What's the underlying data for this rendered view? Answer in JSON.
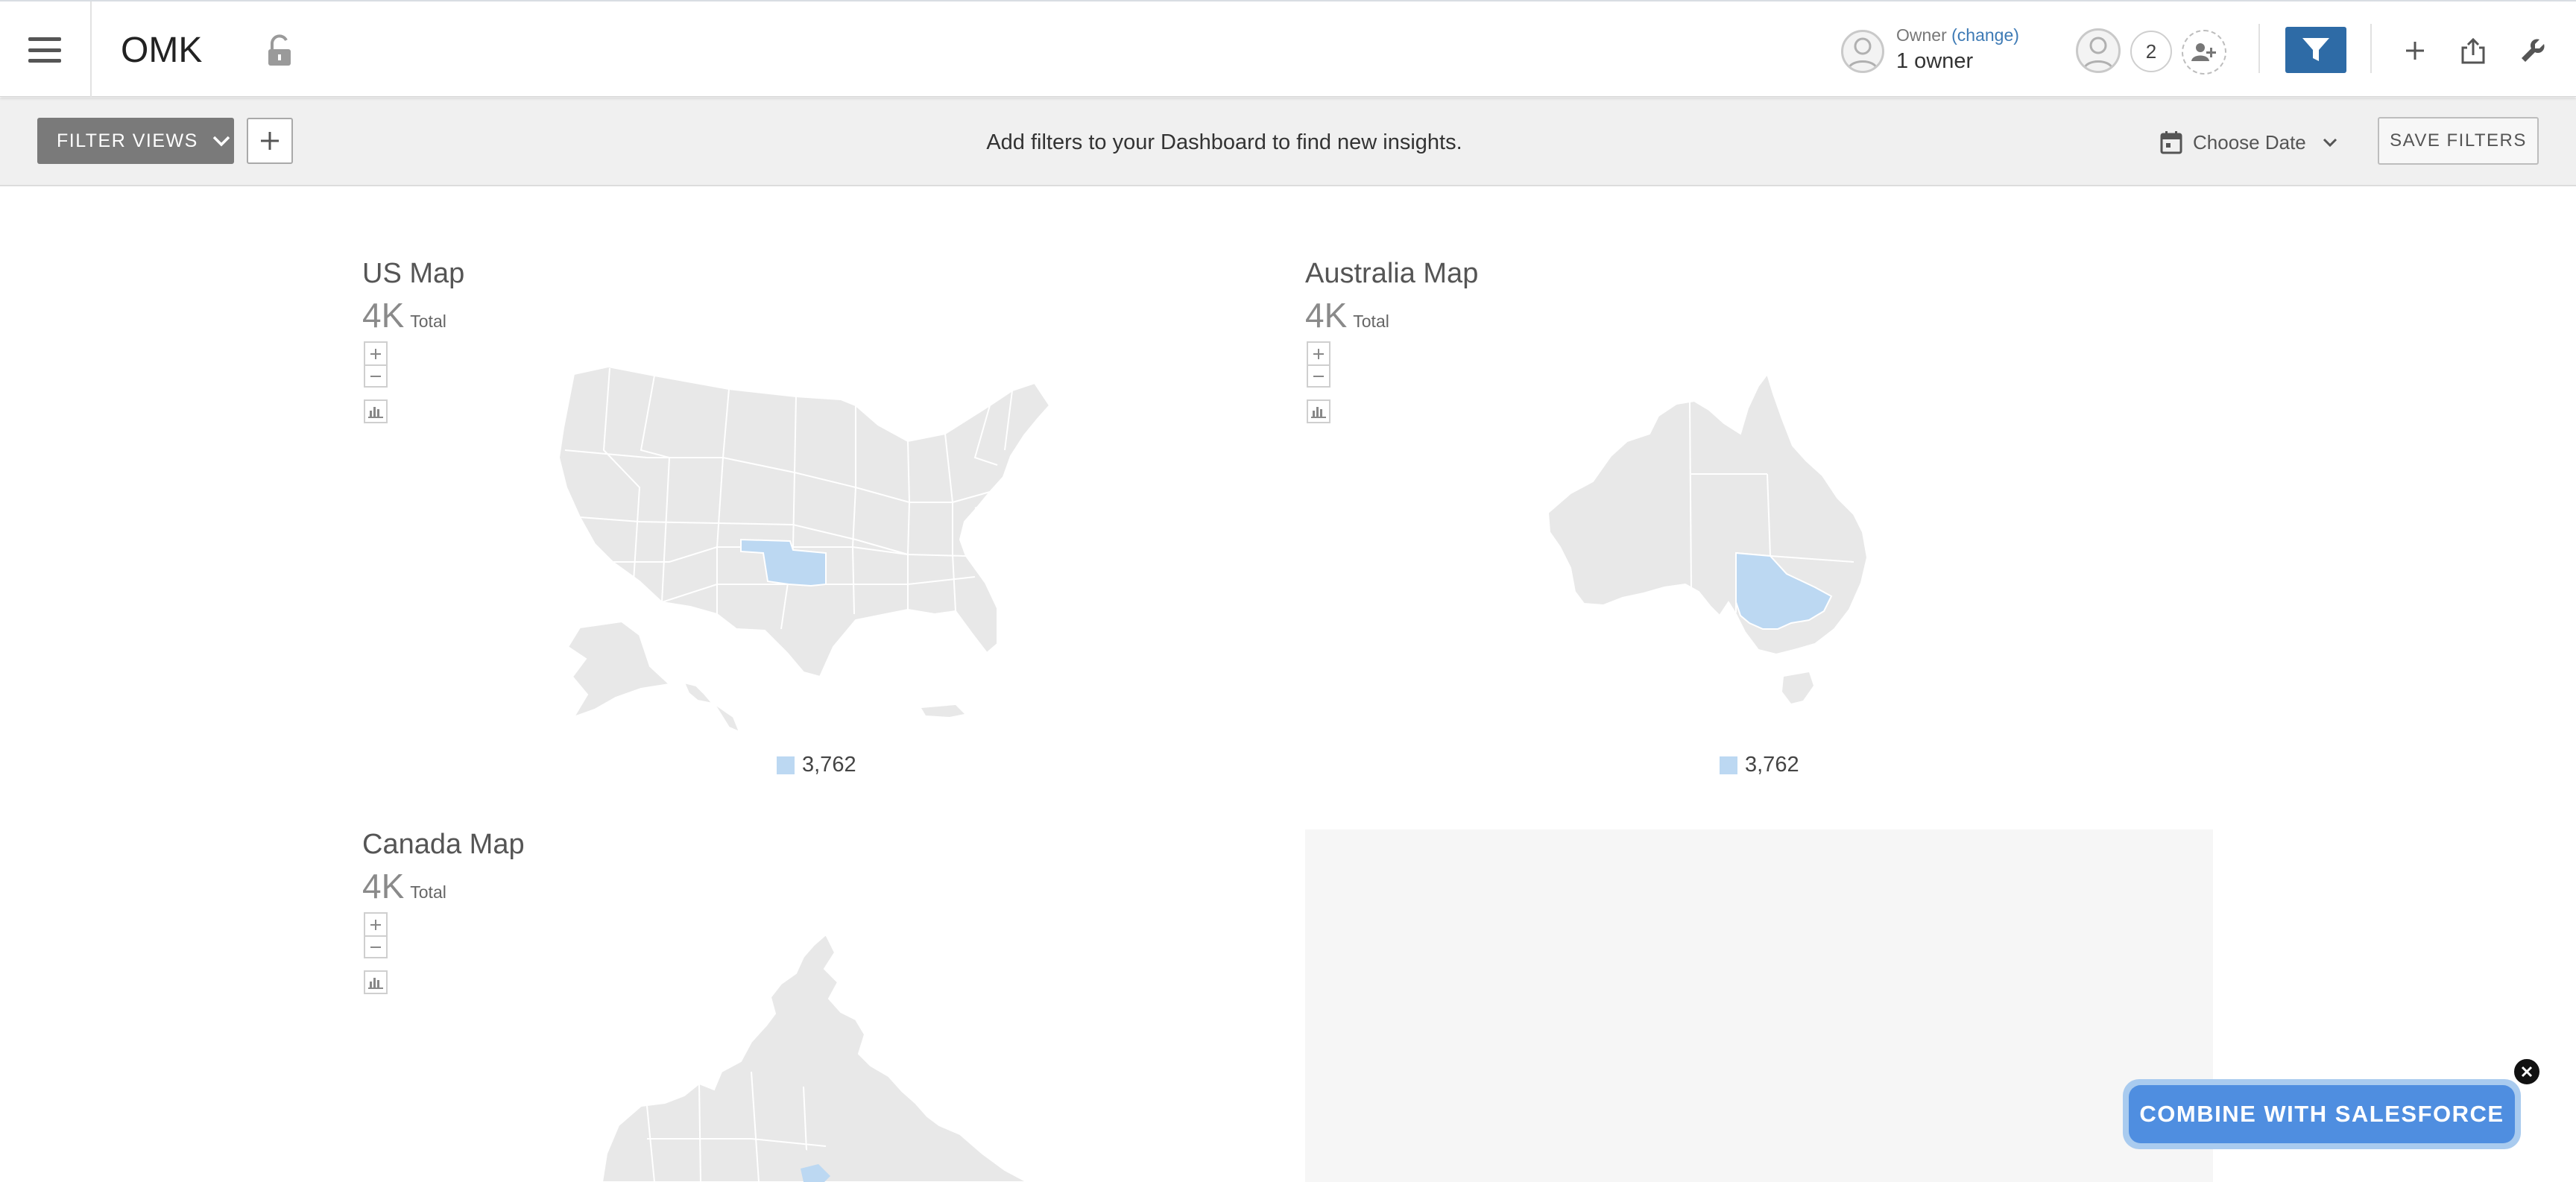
{
  "header": {
    "title": "OMK",
    "owner_label": "Owner",
    "owner_change": "(change)",
    "owner_value": "1 owner",
    "share_count": "2"
  },
  "filterbar": {
    "filter_views_label": "FILTER VIEWS",
    "message": "Add filters to your Dashboard to find new insights.",
    "choose_date_label": "Choose Date",
    "save_filters_label": "SAVE FILTERS"
  },
  "widgets": [
    {
      "title": "US Map",
      "total": "4K",
      "total_label": "Total",
      "legend_value": "3,762",
      "highlight_region": "Oklahoma"
    },
    {
      "title": "Australia Map",
      "total": "4K",
      "total_label": "Total",
      "legend_value": "3,762",
      "highlight_region": "Victoria"
    },
    {
      "title": "Canada Map",
      "total": "4K",
      "total_label": "Total"
    }
  ],
  "cta": {
    "label": "COMBINE WITH SALESFORCE"
  },
  "colors": {
    "primary": "#2e6ba6",
    "map_fill": "#e8e8e8",
    "map_highlight": "#bcd8f2",
    "cta": "#4f8ee0",
    "link": "#3d7ab5"
  },
  "icons": [
    "menu-icon",
    "unlock-icon",
    "user-icon",
    "add-person-icon",
    "filter-icon",
    "plus-icon",
    "share-icon",
    "wrench-icon",
    "calendar-icon",
    "chevron-down-icon",
    "zoom-in-icon",
    "zoom-out-icon",
    "legend-icon",
    "close-icon"
  ]
}
